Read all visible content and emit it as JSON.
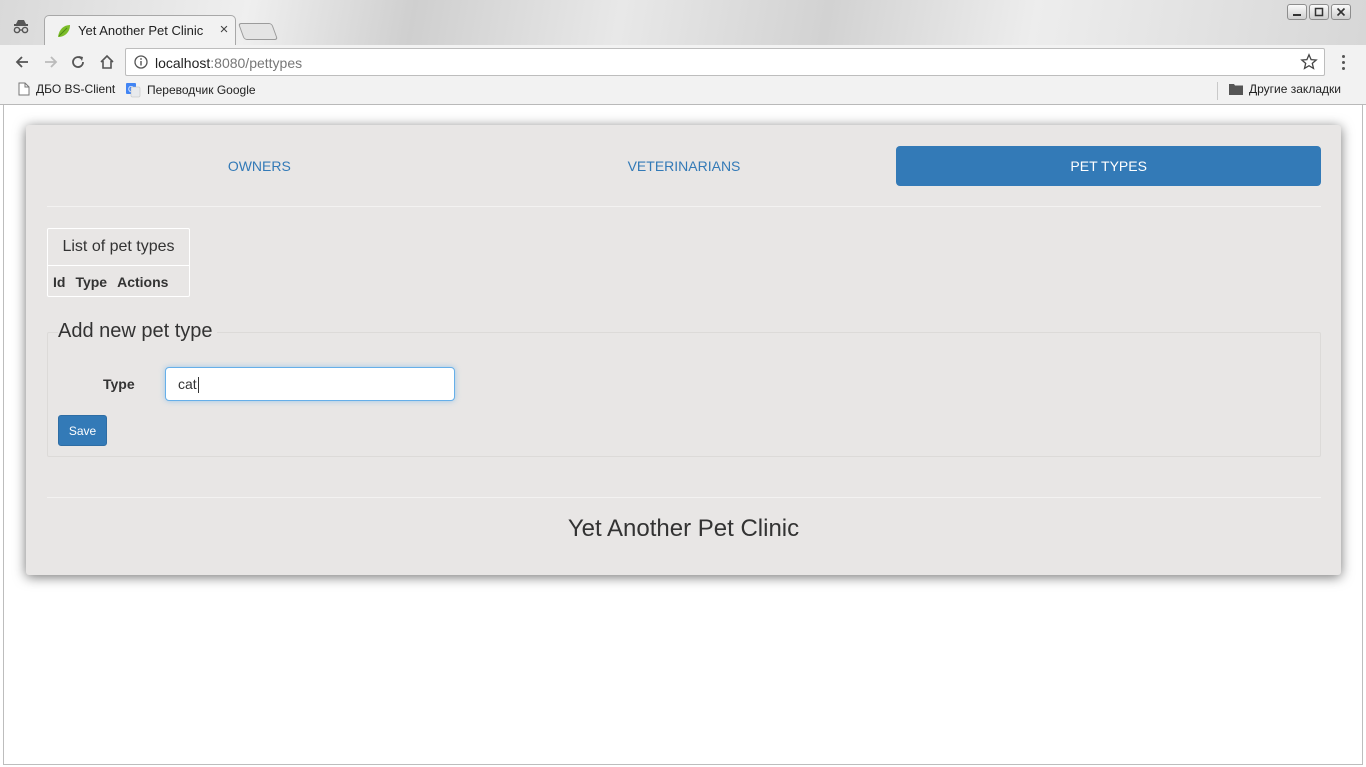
{
  "browser": {
    "tab_title": "Yet Another Pet Clinic",
    "tab_close": "×",
    "url_host": "localhost",
    "url_rest": ":8080/pettypes",
    "bookmarks": [
      {
        "label": "ДБО BS-Client",
        "icon": "page-icon"
      },
      {
        "label": "Переводчик Google",
        "icon": "google-translate-icon"
      }
    ],
    "other_bookmarks": "Другие закладки"
  },
  "nav": {
    "items": [
      {
        "label": "OWNERS",
        "active": false
      },
      {
        "label": "VETERINARIANS",
        "active": false
      },
      {
        "label": "PET TYPES",
        "active": true
      }
    ]
  },
  "pet_types_table": {
    "caption": "List of pet types",
    "headers": [
      "Id",
      "Type",
      "Actions"
    ]
  },
  "form": {
    "legend": "Add new pet type",
    "type_label": "Type",
    "type_value": "cat",
    "save_label": "Save"
  },
  "footer": {
    "title": "Yet Another Pet Clinic"
  },
  "colors": {
    "accent": "#337ab7",
    "card_bg": "#e8e6e5"
  }
}
